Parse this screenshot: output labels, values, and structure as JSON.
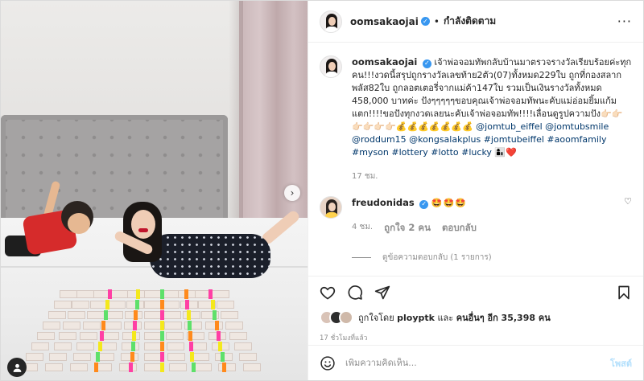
{
  "post": {
    "username": "oomsakaojai",
    "follow_status": "กำลังติดตาม",
    "more_icon": "more-options-icon",
    "caption": {
      "username": "oomsakaojai",
      "text": "เจ้าพ่อจอมทัพกลับบ้านมาตรวจรางวัลเรียบร้อยค่ะทุกคน!!!งวดนี้สรุปถูกรางวัลเลขท้าย2ตัว(07)ทั้งหมด229ใบ ถูกที่กองสลากพลัส82ใบ ถูกลอตเตอรี่จากแม่ค้า147ใบ รวมเป็นเงินรางวัลทั้งหมด 458,000 บาทค่ะ ปังๆๆๆๆๆขอบคุณเจ้าพ่อจอมทัพนะคับแม่อ่อมยิ้มแก้มแตก!!!!ขอปังทุกงวดเลยนะคับเจ้าพ่อจอมทัพ!!!!เลื่อนดูรูปความปัง👉🏻👉🏻👉🏻👉🏻👉🏻👉🏻💰💰💰💰💰💰💰",
      "tags": "@jomtub_eiffel @jomtubsmile @roddum15 @kongsalakplus #jomtubeiffel #aoomfamily #myson #lottery #lotto #lucky 👩‍👦❤️",
      "time": "17 ชม."
    },
    "comment": {
      "username": "freudonidas",
      "text": "🤩🤩🤩",
      "time": "4 ชม.",
      "likes": "ถูกใจ 2 คน",
      "reply": "ตอบกลับ",
      "view_replies": "ดูข้อความตอบกลับ (1 รายการ)"
    },
    "liked_by": {
      "prefix": "ถูกใจโดย",
      "user": "ployptk",
      "connector": "และ",
      "others": "คนอื่นๆ อีก 35,398 คน"
    },
    "timestamp": "17 ชั่วโมงที่แล้ว",
    "add_comment": {
      "placeholder": "เพิ่มความคิดเห็น...",
      "post_label": "โพสต์"
    }
  },
  "colors": {
    "link": "#00376b",
    "verified": "#3897f0",
    "post_disabled": "#b2dffc",
    "secondary_text": "#8e8e8e"
  }
}
